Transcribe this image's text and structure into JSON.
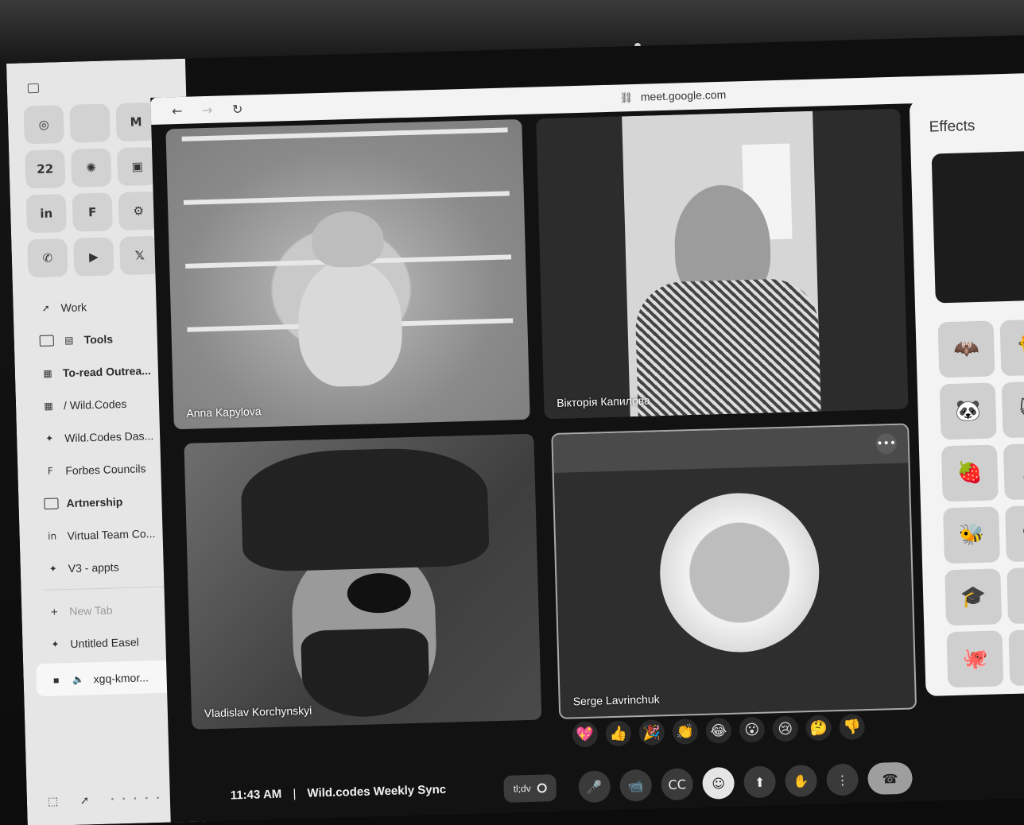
{
  "browser": {
    "url": "meet.google.com",
    "back_icon": "←",
    "forward_icon": "→",
    "reload_icon": "↻",
    "link_icon": "⛓"
  },
  "sidebar": {
    "favorites": [
      {
        "icon": "record-icon",
        "glyph": "◎"
      },
      {
        "icon": "blank-icon",
        "glyph": ""
      },
      {
        "icon": "gmail-icon",
        "glyph": "M"
      },
      {
        "icon": "calendar-icon",
        "glyph": "22"
      },
      {
        "icon": "openai-icon",
        "glyph": "✺"
      },
      {
        "icon": "app-icon",
        "glyph": "▣"
      },
      {
        "icon": "linkedin-icon",
        "glyph": "in"
      },
      {
        "icon": "figma-icon",
        "glyph": "F"
      },
      {
        "icon": "hubspot-icon",
        "glyph": "⚙"
      },
      {
        "icon": "whatsapp-icon",
        "glyph": "✆"
      },
      {
        "icon": "youtube-icon",
        "glyph": "▶"
      },
      {
        "icon": "x-icon",
        "glyph": "𝕏"
      }
    ],
    "items": [
      {
        "label": "Work",
        "icon": "rocket-icon",
        "glyph": "➚",
        "bold": false,
        "folder": false
      },
      {
        "label": "Tools",
        "icon": "toolbox-icon",
        "glyph": "▤",
        "bold": true,
        "folder": true
      },
      {
        "label": "To-read Outrea...",
        "icon": "doc-icon",
        "glyph": "▦",
        "bold": true,
        "folder": false
      },
      {
        "label": "/ Wild.Codes",
        "icon": "grid-icon",
        "glyph": "▦",
        "bold": false,
        "folder": false
      },
      {
        "label": "Wild.Codes Das...",
        "icon": "wildcodes-icon",
        "glyph": "✦",
        "bold": false,
        "folder": false
      },
      {
        "label": "Forbes Councils",
        "icon": "forbes-icon",
        "glyph": "F",
        "bold": false,
        "folder": false
      },
      {
        "label": "Artnership",
        "icon": "folder-icon",
        "glyph": "",
        "bold": true,
        "folder": true
      },
      {
        "label": "Virtual Team Co...",
        "icon": "linkedin-icon",
        "glyph": "in",
        "bold": false,
        "folder": false
      },
      {
        "label": "V3 - appts",
        "icon": "wildcodes-icon",
        "glyph": "✦",
        "bold": false,
        "folder": false
      }
    ],
    "new_tab": "New Tab",
    "untitled": "Untitled Easel",
    "active_tab": "xgq-kmor...",
    "bottom_plus": "+"
  },
  "participants": [
    {
      "name": "Anna Kapylova"
    },
    {
      "name": "Вікторія Капилова"
    },
    {
      "name": "Vladislav Korchynskyi"
    },
    {
      "name": "Serge Lavrinchuk"
    }
  ],
  "effects": {
    "title": "Effects",
    "items": [
      "🦇",
      "🐈",
      "🐼",
      "🐱",
      "🍓",
      "🐰",
      "🐝",
      "🐵",
      "🎓",
      "🐟",
      "🐙",
      "⏰"
    ]
  },
  "reactions": [
    "💖",
    "👍",
    "🎉",
    "👏",
    "😂",
    "😮",
    "😢",
    "🤔",
    "👎"
  ],
  "meeting": {
    "time": "11:43 AM",
    "separator": "|",
    "title": "Wild.codes Weekly Sync"
  },
  "controls": {
    "tldv_label": "tl;dv",
    "mic": "🎤",
    "camera": "📹",
    "captions": "CC",
    "emoji": "☺",
    "present": "⬆",
    "hand": "✋",
    "more": "⋮",
    "end": "☎"
  },
  "more_options": "•••"
}
